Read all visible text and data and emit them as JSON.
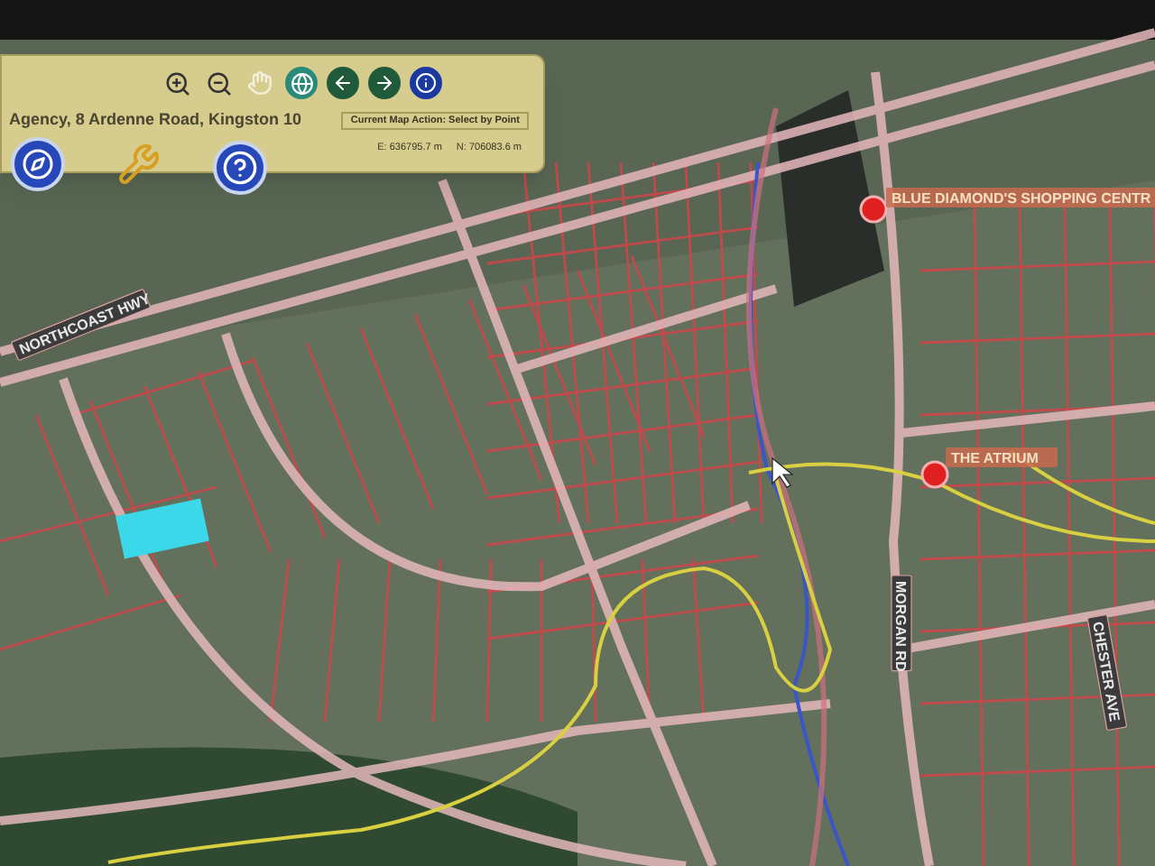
{
  "panel": {
    "address": "Agency, 8 Ardenne Road, Kingston 10",
    "map_action": "Current Map Action: Select by Point",
    "easting": "E: 636795.7 m",
    "northing": "N: 706083.6 m"
  },
  "map_labels": [
    {
      "text": "NORTHCOAST HWY",
      "kind": "road"
    },
    {
      "text": "BLUE DIAMOND'S SHOPPING CENTR",
      "kind": "place"
    },
    {
      "text": "THE ATRIUM",
      "kind": "place"
    },
    {
      "text": "MORGAN RD",
      "kind": "road"
    },
    {
      "text": "CHESTER AVE",
      "kind": "road"
    }
  ]
}
